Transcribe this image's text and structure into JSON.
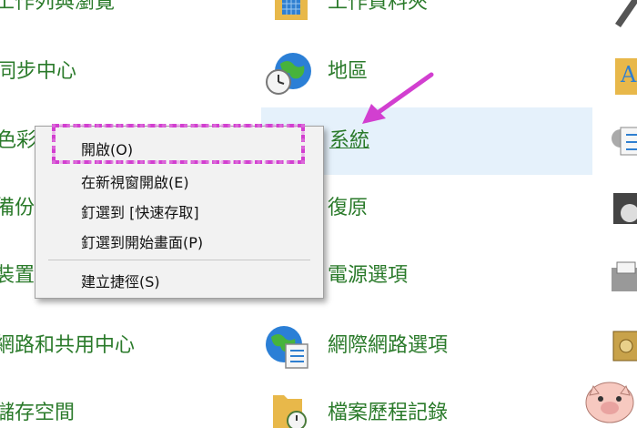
{
  "left_column": [
    "工作列與瀏覽",
    "同步中心",
    "色彩管",
    "備份與",
    "裝置管",
    "網路和共用中心",
    "儲存空間"
  ],
  "middle_column": [
    "工作資料夾",
    "地區",
    "系統",
    "復原",
    "電源選項",
    "網際網路選項",
    "檔案歷程記錄"
  ],
  "context_menu": {
    "items": [
      "開啟(O)",
      "在新視窗開啟(E)",
      "釘選到 [快速存取]",
      "釘選到開始畫面(P)"
    ],
    "create_shortcut": "建立捷徑(S)"
  },
  "colors": {
    "text_green": "#2a7a2a",
    "annotation": "#d23fd0",
    "hover_bg": "#e5f1fb"
  },
  "icons": [
    "work-folders-icon",
    "region-globe-clock-icon",
    "system-icon",
    "recovery-icon",
    "power-options-icon",
    "internet-options-globe-icon",
    "file-history-icon"
  ]
}
